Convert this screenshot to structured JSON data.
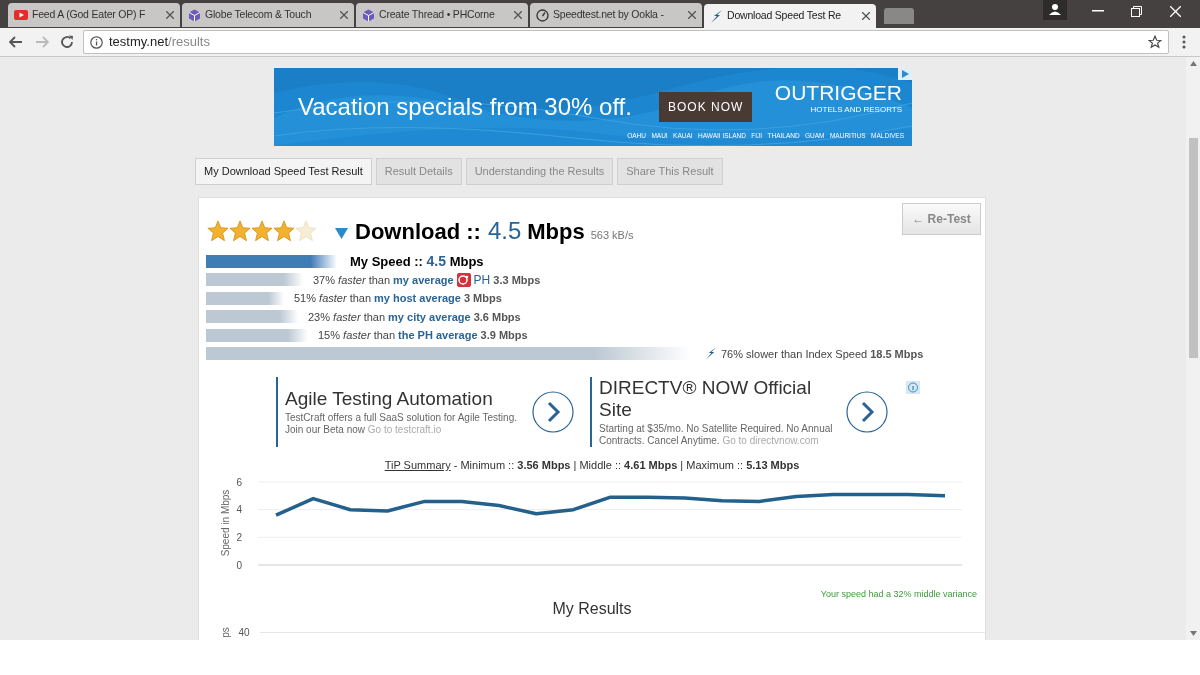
{
  "browser_tabs": [
    {
      "title": "Feed A (God Eater OP) F",
      "selected": false
    },
    {
      "title": "Globe Telecom & Touch",
      "selected": false
    },
    {
      "title": "Create Thread • PHCorne",
      "selected": false
    },
    {
      "title": "Speedtest.net by Ookla -",
      "selected": false
    },
    {
      "title": "Download Speed Test Re",
      "selected": true
    }
  ],
  "address_bar": {
    "host": "testmy.net",
    "path": "/results"
  },
  "banner_ad": {
    "headline": "Vacation specials from 30% off.",
    "button": "BOOK NOW",
    "brand": "OUTRIGGER",
    "tagline": "HOTELS AND RESORTS",
    "places": "OAHU   MAUI   KAUAI   HAWAII ISLAND   FIJI   THAILAND   GUAM   MAURITIUS   MALDIVES"
  },
  "page_tabs": [
    {
      "label": "My Download Speed Test Result",
      "selected": true
    },
    {
      "label": "Result Details",
      "selected": false
    },
    {
      "label": "Understanding the Results",
      "selected": false
    },
    {
      "label": "Share This Result",
      "selected": false
    }
  ],
  "result": {
    "stars": 4,
    "title": "Download ::",
    "speed": "4.5",
    "unit": "Mbps",
    "rate": "563 kB/s",
    "retest_button": "← Re-Test"
  },
  "speed_rows": [
    {
      "kind": "mine",
      "label": "My  Speed ::",
      "speed": "4.5",
      "unit": "Mbps"
    },
    {
      "kind": "compare",
      "lead": "37% *faster* than",
      "link": "my average",
      "country": "PH",
      "value": "3.3 Mbps"
    },
    {
      "kind": "compare",
      "lead": "51% *faster* than",
      "link": "my host average",
      "value": "3 Mbps"
    },
    {
      "kind": "compare",
      "lead": "23% *faster* than",
      "link": "my city average",
      "value": "3.6 Mbps"
    },
    {
      "kind": "compare",
      "lead": "15% *faster* than",
      "link": "the PH average",
      "value": "3.9 Mbps"
    },
    {
      "kind": "index",
      "lead": "76% slower than Index Speed",
      "value": "18.5 Mbps"
    }
  ],
  "text_ads": [
    {
      "title": "Agile Testing Automation",
      "body": "TestCraft offers a full SaaS solution for Agile Testing. Join our Beta now",
      "link": "Go to testcraft.io"
    },
    {
      "title": "DIRECTV® NOW Official Site",
      "body": "Starting at $35/mo. No Satellite Required. No Annual Contracts. Cancel Anytime.",
      "link": "Go to directvnow.com"
    }
  ],
  "summary": {
    "link": "TiP Summary",
    "text": "- Minimum :: **3.56 Mbps** | Middle :: **4.61 Mbps** | Maximum :: **5.13 Mbps**"
  },
  "chart_data": {
    "type": "line",
    "ylabel": "Speed in Mbps",
    "ylim": [
      0,
      6
    ],
    "yticks": [
      0,
      2,
      4,
      6
    ],
    "series": [
      {
        "color": "#23608c",
        "values": [
          3.6,
          4.8,
          4.0,
          3.9,
          4.6,
          4.6,
          4.3,
          3.7,
          4.0,
          4.9,
          4.9,
          4.85,
          4.65,
          4.6,
          4.95,
          5.1,
          5.1,
          5.1,
          5.0
        ]
      }
    ]
  },
  "variance_note": "Your speed had a 32% middle variance",
  "results_chart": {
    "title": "My Results",
    "tick": "40",
    "ylabel": "ps"
  }
}
